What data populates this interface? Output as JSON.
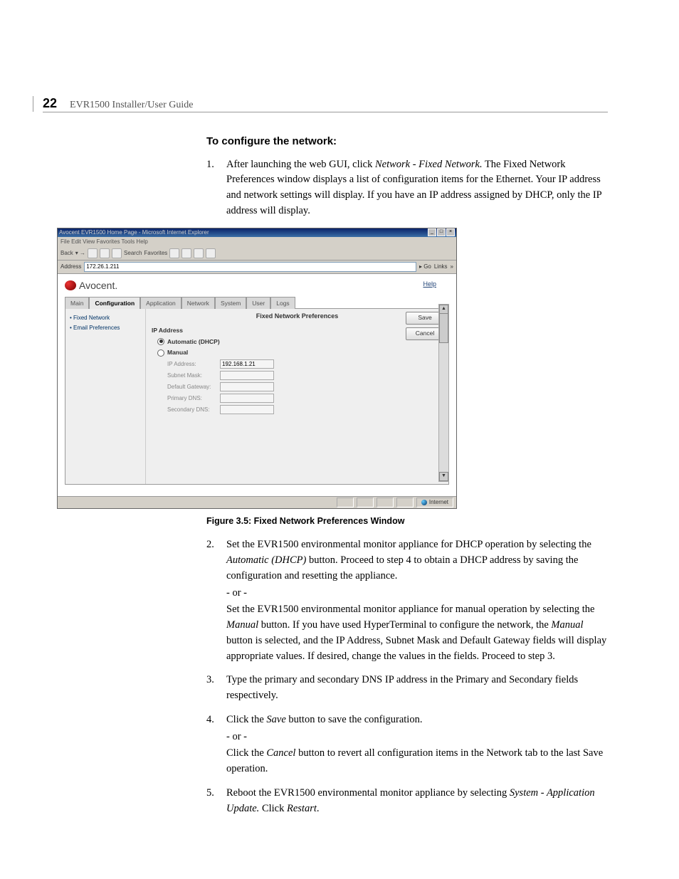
{
  "header": {
    "page_number": "22",
    "title": "EVR1500 Installer/User Guide"
  },
  "section": {
    "heading": "To configure the network:"
  },
  "steps": {
    "s1_num": "1.",
    "s1_a": "After launching the web GUI, click ",
    "s1_b": "Network - Fixed Network.",
    "s1_c": " The Fixed Network Preferences window displays a list of configuration items for the Ethernet. Your IP address and network settings will display. If you have an IP address assigned by DHCP, only the IP address will display.",
    "s2_num": "2.",
    "s2_a": "Set the EVR1500 environmental monitor appliance for DHCP operation by selecting the ",
    "s2_b": "Automatic (DHCP)",
    "s2_c": " button. Proceed to step 4 to obtain a DHCP address by saving the configuration and resetting the appliance.",
    "s2_or": "- or -",
    "s2_d": "Set the EVR1500 environmental monitor appliance for manual operation by selecting the ",
    "s2_e": "Manual",
    "s2_f": " button. If you have used HyperTerminal to configure the network, the ",
    "s2_g": "Manual",
    "s2_h": " button is selected, and the IP Address, Subnet Mask and Default Gateway fields will display appropriate values. If desired, change the values in the fields. Proceed to step 3.",
    "s3_num": "3.",
    "s3": "Type the primary and secondary DNS IP address in the Primary and Secondary fields respectively.",
    "s4_num": "4.",
    "s4_a": "Click the ",
    "s4_b": "Save",
    "s4_c": " button to save the configuration.",
    "s4_or": "- or -",
    "s4_d": "Click the ",
    "s4_e": "Cancel",
    "s4_f": " button to revert all configuration items in the Network tab to the last Save operation.",
    "s5_num": "5.",
    "s5_a": " Reboot the EVR1500 environmental monitor appliance by selecting ",
    "s5_b": "System - Application Update.",
    "s5_c": " Click ",
    "s5_d": "Restart",
    "s5_e": "."
  },
  "figure": {
    "caption": "Figure 3.5: Fixed Network Preferences Window"
  },
  "screenshot": {
    "window_title": "Avocent EVR1500 Home Page - Microsoft Internet Explorer",
    "menu": "File   Edit   View   Favorites   Tools   Help",
    "toolbar_back": "Back",
    "toolbar_search": "Search",
    "toolbar_favorites": "Favorites",
    "addr_label": "Address",
    "addr_value": "172.26.1.211",
    "go": "Go",
    "links": "Links",
    "brand": "Avocent.",
    "help": "Help",
    "tabs": {
      "t0": "Main",
      "t1": "Configuration",
      "t2": "Application",
      "t3": "Network",
      "t4": "System",
      "t5": "User",
      "t6": "Logs"
    },
    "side": {
      "a0": "Fixed Network",
      "a1": "Email Preferences"
    },
    "panel_title": "Fixed Network Preferences",
    "group": "IP Address",
    "radio_auto": "Automatic (DHCP)",
    "radio_manual": "Manual",
    "fields": {
      "ip_label": "IP Address:",
      "ip_value": "192.168.1.21",
      "mask_label": "Subnet Mask:",
      "gw_label": "Default Gateway:",
      "pdns_label": "Primary DNS:",
      "sdns_label": "Secondary DNS:"
    },
    "btn_save": "Save",
    "btn_cancel": "Cancel",
    "status_internet": "Internet"
  }
}
